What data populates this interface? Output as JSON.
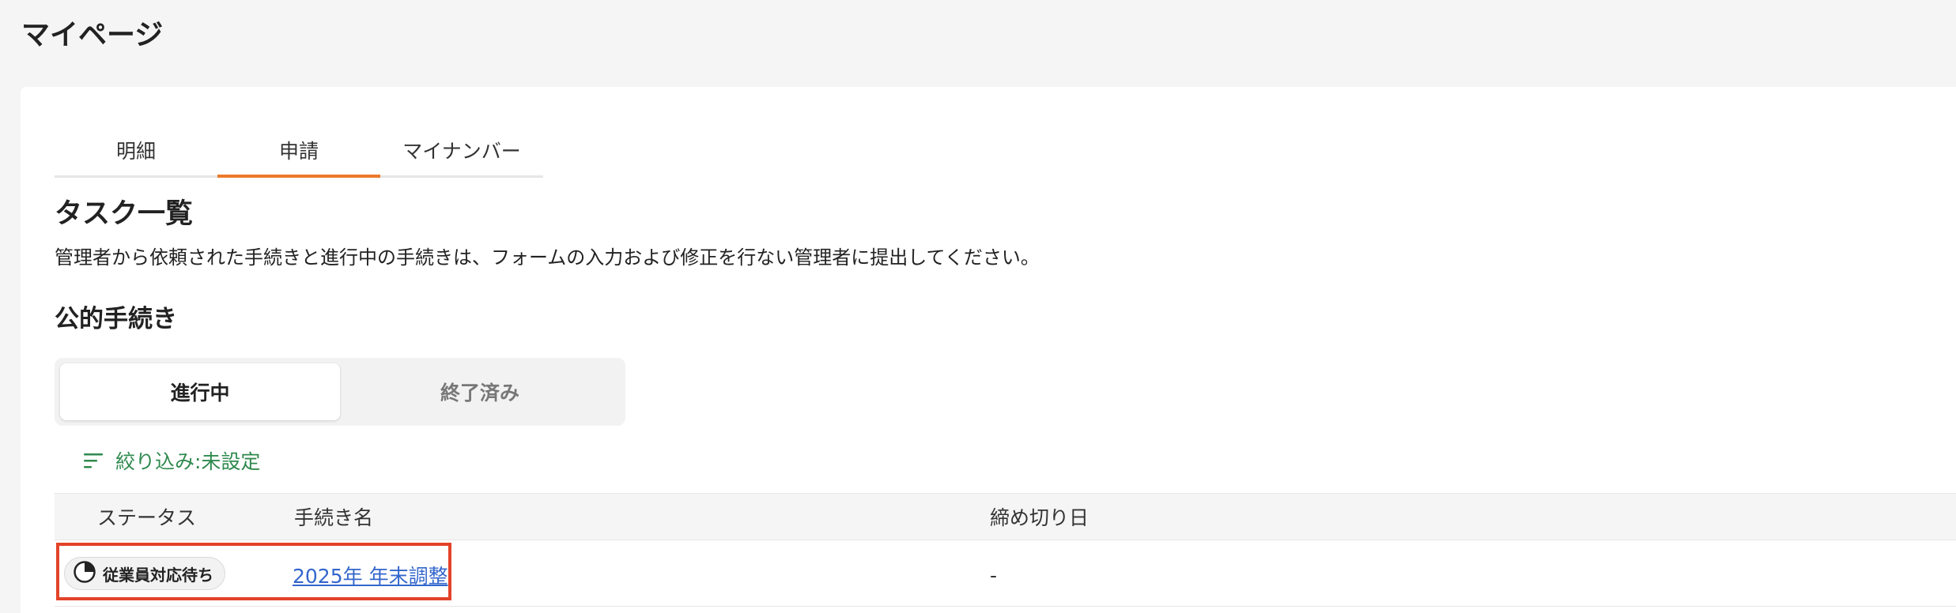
{
  "page": {
    "title": "マイページ"
  },
  "tabs": [
    {
      "label": "明細"
    },
    {
      "label": "申請"
    },
    {
      "label": "マイナンバー"
    }
  ],
  "task_section": {
    "title": "タスク一覧",
    "description": "管理者から依頼された手続きと進行中の手続きは、フォームの入力および修正を行ない管理者に提出してください。"
  },
  "public_procedures": {
    "title": "公的手続き",
    "segments": [
      {
        "label": "進行中"
      },
      {
        "label": "終了済み"
      }
    ],
    "filter_label": "絞り込み:未設定",
    "table": {
      "columns": [
        "ステータス",
        "手続き名",
        "締め切り日"
      ],
      "rows": [
        {
          "status": "従業員対応待ち",
          "name": "2025年 年末調整",
          "deadline": "-"
        }
      ]
    }
  },
  "colors": {
    "active_tab_underline": "#ec7a2c",
    "filter_green": "#2f8a4e",
    "link_blue": "#3366cc",
    "highlight_red": "#e3432a"
  },
  "icons": {
    "filter": "filter-lines-icon",
    "status": "pie-progress-icon"
  }
}
